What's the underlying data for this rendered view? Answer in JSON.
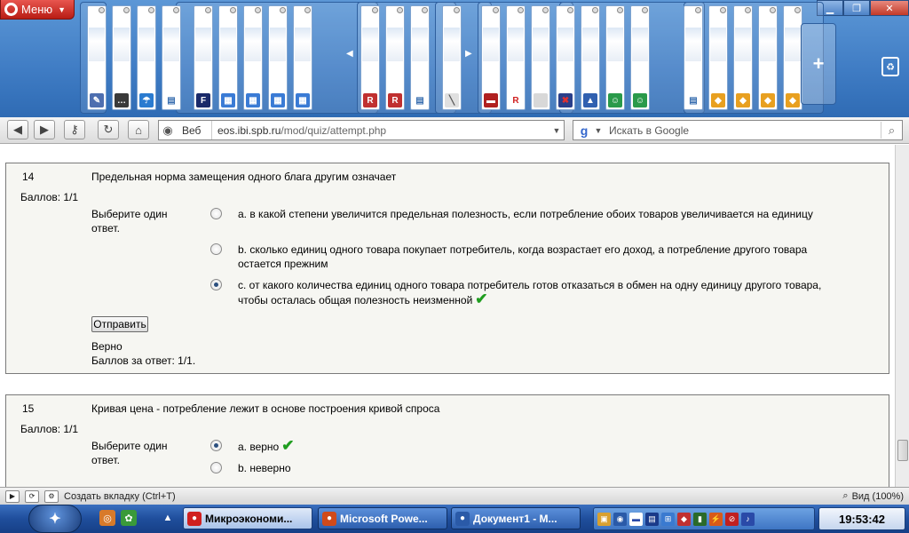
{
  "browser": {
    "menu_label": "Меню",
    "address": {
      "scheme_label": "Веб",
      "host": "eos.ibi.spb.ru",
      "path": "/mod/quiz/attempt.php"
    },
    "search": {
      "placeholder": "Искать в Google"
    }
  },
  "tabs": [
    {
      "icon": "palette-icon",
      "color": "#4e6fb0",
      "glyph": "✎",
      "fg": "#fff"
    },
    {
      "icon": "chat-icon",
      "color": "#3a3a3a",
      "glyph": "…",
      "fg": "#fff"
    },
    {
      "icon": "trophy-icon",
      "color": "#2a7bd0",
      "glyph": "☂",
      "fg": "#fff"
    },
    {
      "icon": "page-icon",
      "color": "#ffffff",
      "glyph": "▤",
      "fg": "#3a6fb0"
    },
    {
      "icon": "f-logo-icon",
      "color": "#1a2a6a",
      "glyph": "F",
      "fg": "#fff"
    },
    {
      "icon": "window-icon",
      "color": "#3a7bd5",
      "glyph": "▦",
      "fg": "#fff"
    },
    {
      "icon": "window-icon",
      "color": "#3a7bd5",
      "glyph": "▦",
      "fg": "#fff"
    },
    {
      "icon": "window-icon",
      "color": "#3a7bd5",
      "glyph": "▦",
      "fg": "#fff"
    },
    {
      "icon": "window-icon",
      "color": "#3a7bd5",
      "glyph": "▦",
      "fg": "#fff"
    },
    {
      "icon": "rb-logo-icon",
      "color": "#c03030",
      "glyph": "R",
      "fg": "#fff"
    },
    {
      "icon": "rb-logo-icon",
      "color": "#c03030",
      "glyph": "R",
      "fg": "#fff"
    },
    {
      "icon": "page-icon",
      "color": "#ffffff",
      "glyph": "▤",
      "fg": "#3a6fb0"
    },
    {
      "icon": "needle-icon",
      "color": "#e0e0e0",
      "glyph": "╲",
      "fg": "#555"
    },
    {
      "icon": "flag-icon",
      "color": "#b02020",
      "glyph": "▬",
      "fg": "#fff"
    },
    {
      "icon": "r-logo-icon",
      "color": "#ffffff",
      "glyph": "R",
      "fg": "#d02020"
    },
    {
      "icon": "blank-icon",
      "color": "#d8d8d8",
      "glyph": "",
      "fg": "#fff"
    },
    {
      "icon": "uk-flag-icon",
      "color": "#2a3f8a",
      "glyph": "✖",
      "fg": "#e03030"
    },
    {
      "icon": "bottle-icon",
      "color": "#3060b0",
      "glyph": "▲",
      "fg": "#fff"
    },
    {
      "icon": "odnoklassniki-icon",
      "color": "#2a9a4a",
      "glyph": "☺",
      "fg": "#fff"
    },
    {
      "icon": "odnoklassniki-icon",
      "color": "#2a9a4a",
      "glyph": "☺",
      "fg": "#fff"
    },
    {
      "icon": "page-icon",
      "color": "#ffffff",
      "glyph": "▤",
      "fg": "#3a6fb0"
    },
    {
      "icon": "graduation-cap-icon",
      "color": "#e8a020",
      "glyph": "◆",
      "fg": "#fff"
    },
    {
      "icon": "graduation-cap-icon",
      "color": "#e8a020",
      "glyph": "◆",
      "fg": "#fff"
    },
    {
      "icon": "graduation-cap-icon",
      "color": "#e8a020",
      "glyph": "◆",
      "fg": "#fff"
    },
    {
      "icon": "graduation-cap-icon",
      "color": "#e8a020",
      "glyph": "◆",
      "fg": "#fff"
    }
  ],
  "questions": [
    {
      "number": "14",
      "text": "Предельная норма замещения одного блага другим означает",
      "grade": "Баллов: 1/1",
      "prompt": "Выберите один ответ.",
      "options": [
        {
          "text": "a. в какой степени увеличится предельная полезность, если потребление обоих товаров увеличивается на единицу",
          "selected": false
        },
        {
          "text": "b. сколько единиц одного товара покупает потребитель, когда возрастает его доход, а потребление другого товара остается прежним",
          "selected": false
        },
        {
          "text": "c. от какого количества единиц одного товара потребитель готов отказаться в обмен на одну единицу другого товара, чтобы осталась общая полезность неизменной",
          "selected": true,
          "check": true
        }
      ],
      "submit_label": "Отправить",
      "feedback_correct": "Верно",
      "feedback_mark": "Баллов за ответ: 1/1."
    },
    {
      "number": "15",
      "text": "Кривая цена - потребление лежит в основе построения кривой спроса",
      "grade": "Баллов: 1/1",
      "prompt": "Выберите один ответ.",
      "options": [
        {
          "text": "a. верно",
          "selected": true,
          "check": true
        },
        {
          "text": "b. неверно",
          "selected": false
        }
      ]
    }
  ],
  "statusbar": {
    "new_tab_label": "Создать вкладку (Ctrl+T)",
    "zoom_label": "Вид (100%)"
  },
  "taskbar": {
    "items": [
      {
        "label": "Микроэкономи...",
        "active": true,
        "icon": "opera-icon",
        "color": "#d02020"
      },
      {
        "label": "Microsoft Powe...",
        "active": false,
        "icon": "powerpoint-icon",
        "color": "#d04a1a"
      },
      {
        "label": "Документ1 - М...",
        "active": false,
        "icon": "word-icon",
        "color": "#2a5aa8"
      }
    ],
    "clock": "19:53:42"
  }
}
